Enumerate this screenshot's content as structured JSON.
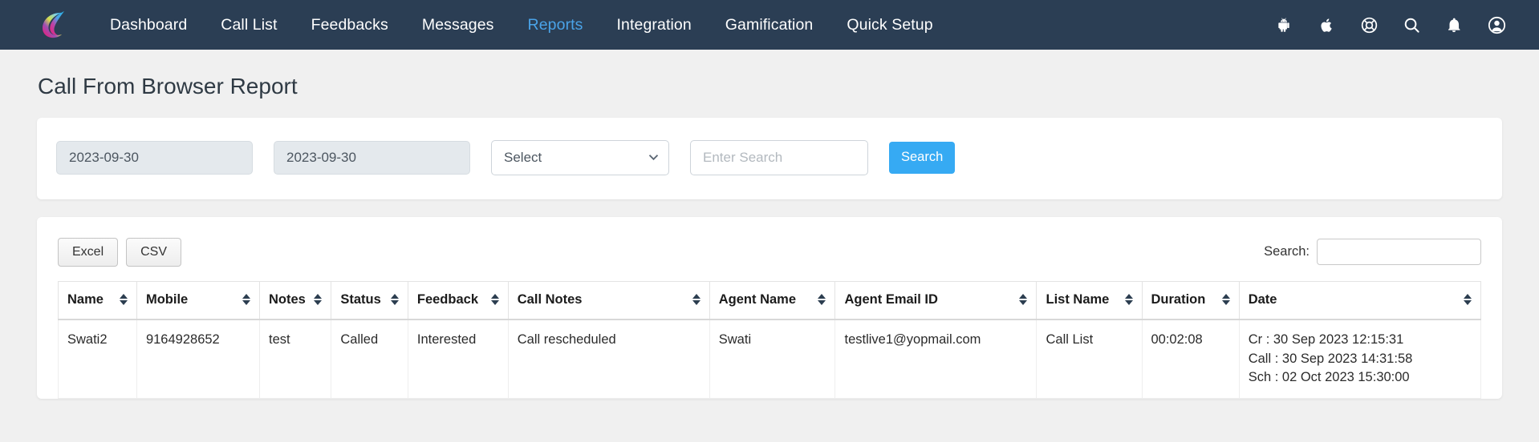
{
  "navbar": {
    "brand_icon": "company-swoosh-logo",
    "links": [
      {
        "label": "Dashboard",
        "active": false
      },
      {
        "label": "Call List",
        "active": false
      },
      {
        "label": "Feedbacks",
        "active": false
      },
      {
        "label": "Messages",
        "active": false
      },
      {
        "label": "Reports",
        "active": true
      },
      {
        "label": "Integration",
        "active": false
      },
      {
        "label": "Gamification",
        "active": false
      },
      {
        "label": "Quick Setup",
        "active": false
      }
    ],
    "icons": [
      {
        "name": "android-icon"
      },
      {
        "name": "apple-icon"
      },
      {
        "name": "life-ring-support-icon"
      },
      {
        "name": "search-icon"
      },
      {
        "name": "notification-bell-icon"
      },
      {
        "name": "user-account-icon"
      }
    ],
    "active_color": "#4aa3e8",
    "background": "#2b3e54"
  },
  "page": {
    "title": "Call From Browser Report"
  },
  "filters": {
    "from_date": "2023-09-30",
    "to_date": "2023-09-30",
    "select_value": "Select",
    "select_options": [
      "Select"
    ],
    "search_placeholder": "Enter Search",
    "search_value": "",
    "search_button_label": "Search",
    "search_button_color": "#36aaf3"
  },
  "table_controls": {
    "excel_label": "Excel",
    "csv_label": "CSV",
    "search_label": "Search:",
    "search_value": ""
  },
  "table": {
    "columns": [
      {
        "label": "Name",
        "sortable": true
      },
      {
        "label": "Mobile",
        "sortable": true
      },
      {
        "label": "Notes",
        "sortable": true
      },
      {
        "label": "Status",
        "sortable": true
      },
      {
        "label": "Feedback",
        "sortable": true
      },
      {
        "label": "Call Notes",
        "sortable": true
      },
      {
        "label": "Agent Name",
        "sortable": true
      },
      {
        "label": "Agent Email ID",
        "sortable": true
      },
      {
        "label": "List Name",
        "sortable": true
      },
      {
        "label": "Duration",
        "sortable": true
      },
      {
        "label": "Date",
        "sortable": true
      }
    ],
    "rows": [
      {
        "name": "Swati2",
        "mobile": "9164928652",
        "notes": "test",
        "status": "Called",
        "feedback": "Interested",
        "call_notes": "Call rescheduled",
        "agent_name": "Swati",
        "agent_email": "testlive1@yopmail.com",
        "list_name": "Call List",
        "duration": "00:02:08",
        "date_created": "Cr : 30 Sep 2023 12:15:31",
        "date_call": "Call : 30 Sep 2023 14:31:58",
        "date_scheduled": "Sch : 02 Oct 2023 15:30:00"
      }
    ]
  }
}
